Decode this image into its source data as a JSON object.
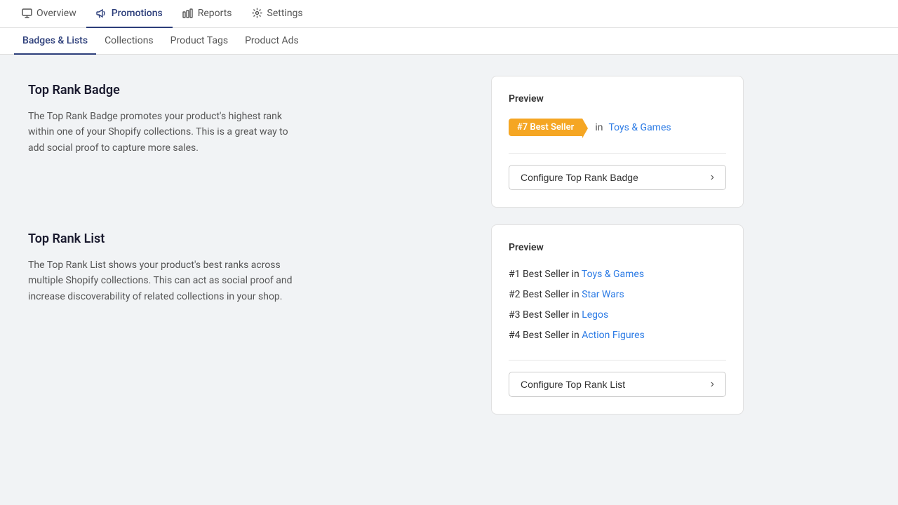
{
  "topNav": {
    "items": [
      {
        "id": "overview",
        "label": "Overview",
        "icon": "monitor",
        "active": false
      },
      {
        "id": "promotions",
        "label": "Promotions",
        "icon": "megaphone",
        "active": true
      },
      {
        "id": "reports",
        "label": "Reports",
        "icon": "bar-chart",
        "active": false
      },
      {
        "id": "settings",
        "label": "Settings",
        "icon": "gear",
        "active": false
      }
    ]
  },
  "subNav": {
    "items": [
      {
        "id": "badges-lists",
        "label": "Badges & Lists",
        "active": true
      },
      {
        "id": "collections",
        "label": "Collections",
        "active": false
      },
      {
        "id": "product-tags",
        "label": "Product Tags",
        "active": false
      },
      {
        "id": "product-ads",
        "label": "Product Ads",
        "active": false
      }
    ]
  },
  "sections": {
    "badge": {
      "title": "Top Rank Badge",
      "description": "The Top Rank Badge promotes your product's highest rank within one of your Shopify collections. This is a great way to add social proof to capture more sales.",
      "preview": {
        "label": "Preview",
        "badgeText": "#7 Best Seller",
        "inText": "in",
        "linkText": "Toys & Games"
      },
      "button": {
        "label": "Configure Top Rank Badge",
        "chevron": "›"
      }
    },
    "list": {
      "title": "Top Rank List",
      "description": "The Top Rank List shows your product's best ranks across multiple Shopify collections. This can act as social proof and increase discoverability of related collections in your shop.",
      "preview": {
        "label": "Preview",
        "items": [
          {
            "rank": "#1 Best Seller in",
            "linkText": "Toys & Games"
          },
          {
            "rank": "#2 Best Seller in",
            "linkText": "Star Wars"
          },
          {
            "rank": "#3 Best Seller in",
            "linkText": "Legos"
          },
          {
            "rank": "#4 Best Seller in",
            "linkText": "Action Figures"
          }
        ]
      },
      "button": {
        "label": "Configure Top Rank List",
        "chevron": "›"
      }
    }
  },
  "colors": {
    "badgeOrange": "#f5a623",
    "linkBlue": "#2c7be5",
    "activeNavBlue": "#2c3e7a"
  }
}
